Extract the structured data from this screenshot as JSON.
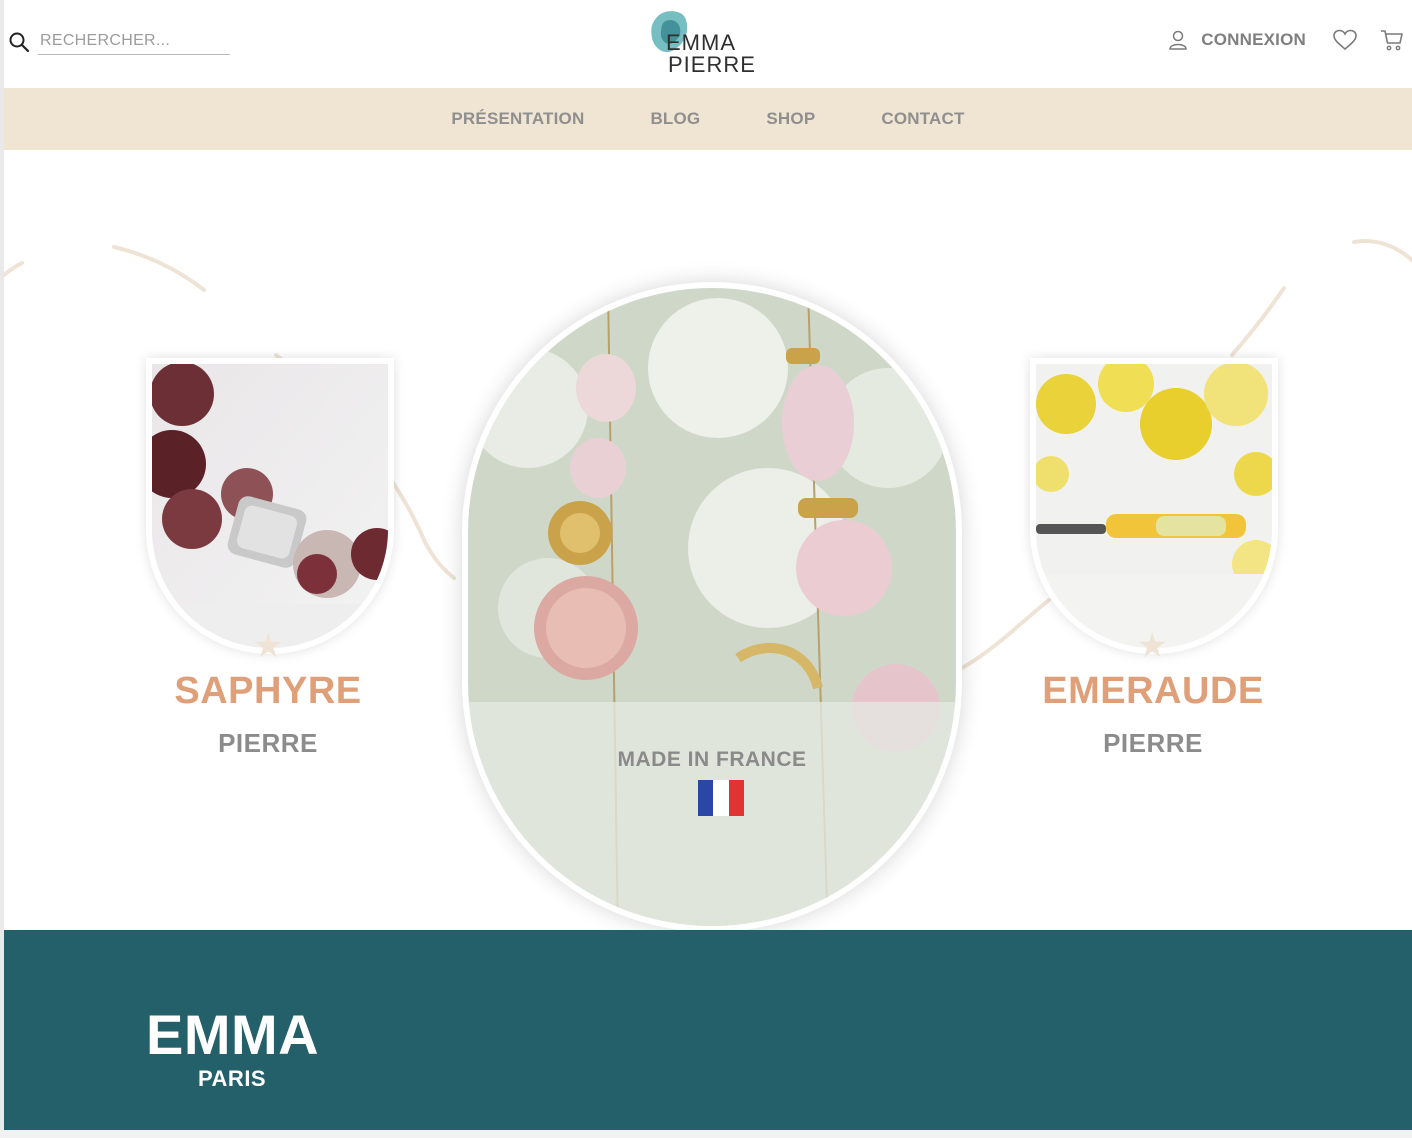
{
  "header": {
    "search": {
      "placeholder": "RECHERCHER..."
    },
    "logo": {
      "line1": "EMMA",
      "line2": "PIERRE"
    },
    "account": {
      "login_label": "CONNEXION"
    }
  },
  "nav": {
    "items": [
      "PRÉSENTATION",
      "BLOG",
      "SHOP",
      "CONTACT"
    ]
  },
  "hero": {
    "left_card": {
      "name": "SAPHYRE",
      "subtitle": "PIERRE"
    },
    "center_card": {
      "label": "MADE IN FRANCE"
    },
    "right_card": {
      "name": "EMERAUDE",
      "subtitle": "PIERRE"
    }
  },
  "footer": {
    "brand": "EMMA",
    "city": "PARIS"
  },
  "colors": {
    "nav_bg": "#f0e4d3",
    "accent_peach": "#dfa079",
    "footer_teal": "#236069",
    "text_gray": "#8a8a8a"
  },
  "icons": [
    "search-icon",
    "user-icon",
    "heart-icon",
    "cart-icon",
    "star-icon",
    "flag-france-icon"
  ]
}
